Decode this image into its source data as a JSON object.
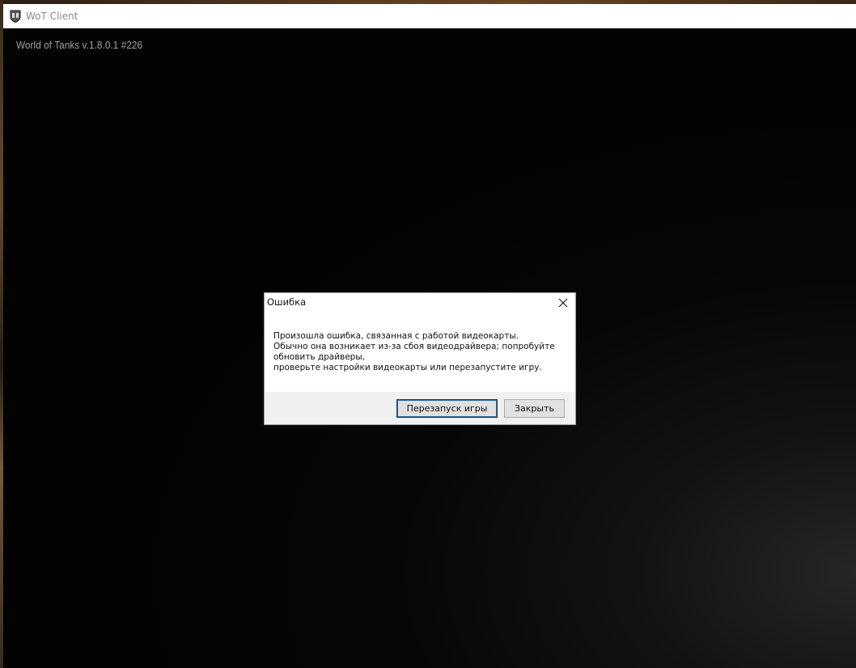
{
  "window": {
    "title": "WoT Client",
    "icon": "wot-tank-shield-icon"
  },
  "game": {
    "version_text": "World of Tanks v.1.8.0.1 #226"
  },
  "dialog": {
    "title": "Ошибка",
    "close_icon": "close-icon",
    "message_lines": [
      "Произошла ошибка, связанная с работой видеокарты.",
      "Обычно она возникает из-за сбоя видеодрайвера; попробуйте обновить драйверы,",
      "проверьте настройки видеокарты или перезапустите игру."
    ],
    "buttons": {
      "restart_label": "Перезапуск игры",
      "close_label": "Закрыть"
    }
  },
  "colors": {
    "background": "#050505",
    "titlebar": "#ffffff",
    "dialog_footer": "#f0f0f0",
    "focus_accent": "#0078d7"
  }
}
